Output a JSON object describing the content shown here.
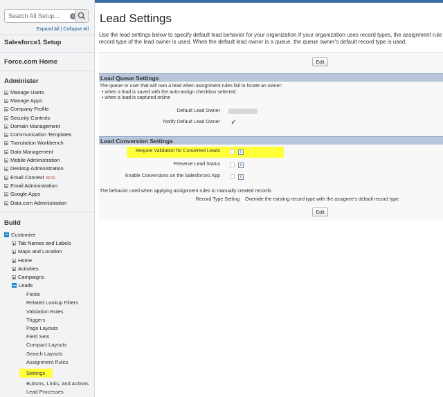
{
  "sidebar": {
    "search_placeholder": "Search All Setup...",
    "expand_all": "Expand All",
    "link_sep": " | ",
    "collapse_all": "Collapse All",
    "salesforce1_setup": "Salesforce1 Setup",
    "force_home": "Force.com Home",
    "administer_heading": "Administer",
    "administer_items": [
      "Manage Users",
      "Manage Apps",
      "Company Profile",
      "Security Controls",
      "Domain Management",
      "Communication Templates",
      "Translation Workbench",
      "Data Management",
      "Mobile Administration",
      "Desktop Administration",
      "Email Connect",
      "Email Administration",
      "Google Apps",
      "Data.com Administration"
    ],
    "beta_label": "BETA",
    "build_heading": "Build",
    "customize": "Customize",
    "customize_children": [
      "Tab Names and Labels",
      "Maps and Location",
      "Home",
      "Activities",
      "Campaigns"
    ],
    "leads": "Leads",
    "leads_children": [
      "Fields",
      "Related Lookup Filters",
      "Validation Rules",
      "Triggers",
      "Page Layouts",
      "Field Sets",
      "Compact Layouts",
      "Search Layouts",
      "Assignment Rules",
      "Settings",
      "Buttons, Links, and Actions",
      "Lead Processes"
    ]
  },
  "main": {
    "title": "Lead Settings",
    "intro_line1": "Use the lead settings below to specify default lead behavior for your organization.If your organization uses record types, the assignment rule",
    "intro_line2": "record type of the lead owner is used. When the default lead owner is a queue, the queue owner's default record type is used.",
    "edit_label": "Edit",
    "queue_section": "Lead Queue Settings",
    "queue_desc": "The queue or user that will own a lead when assignment rules fail to locate an owner:",
    "queue_bullet1": "• when a lead is saved with the auto-assign checkbox selected",
    "queue_bullet2": "• when a lead is captured online",
    "default_owner_label": "Default Lead Owner",
    "notify_label": "Notify Default Lead Owner",
    "notify_checked": "✓",
    "conversion_section": "Lead Conversion Settings",
    "require_validation_label": "Require Validation for Converted Leads",
    "preserve_status_label": "Preserve Lead Status",
    "enable_conversions_label": "Enable Conversions on the Salesforce1 App",
    "info_glyph": "i",
    "behavior_text": "The behavior used when applying assignment rules to manually created records.",
    "record_type_label": "Record Type Setting",
    "record_type_value": "Override the existing record type with the assignee's default record type"
  },
  "colors": {
    "highlight": "#ffff3a",
    "section_header": "#b9c5d9",
    "link": "#1a5a98"
  },
  "icons": {
    "search": "search-icon",
    "info": "info-icon",
    "expand": "expand-triangle-icon",
    "collapse": "collapse-minus-icon"
  }
}
